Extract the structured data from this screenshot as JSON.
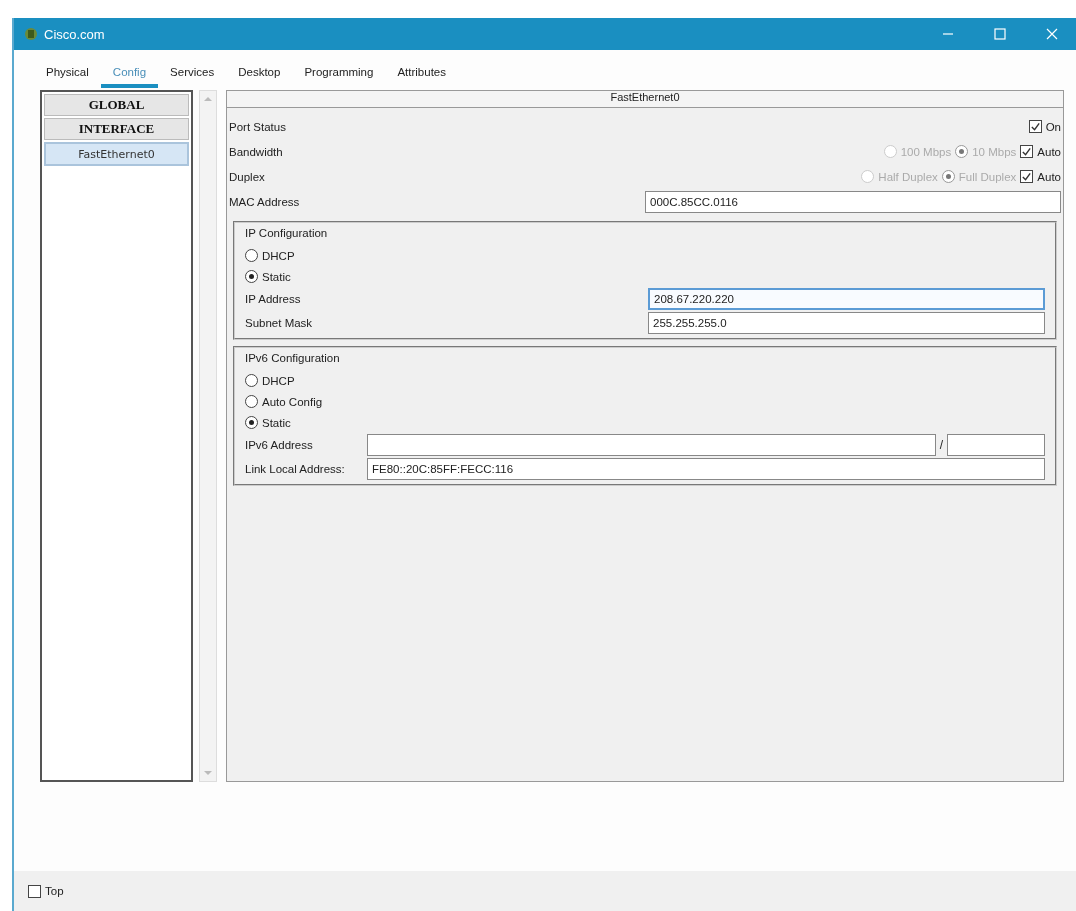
{
  "window": {
    "title": "Cisco.com"
  },
  "tabs": [
    {
      "label": "Physical",
      "selected": false
    },
    {
      "label": "Config",
      "selected": true
    },
    {
      "label": "Services",
      "selected": false
    },
    {
      "label": "Desktop",
      "selected": false
    },
    {
      "label": "Programming",
      "selected": false
    },
    {
      "label": "Attributes",
      "selected": false
    }
  ],
  "sidebar": {
    "items": [
      {
        "label": "GLOBAL",
        "kind": "header",
        "selected": false
      },
      {
        "label": "INTERFACE",
        "kind": "header",
        "selected": false
      },
      {
        "label": "FastEthernet0",
        "kind": "item",
        "selected": true
      }
    ]
  },
  "panel": {
    "title": "FastEthernet0",
    "port_status": {
      "label": "Port Status",
      "on": {
        "label": "On",
        "checked": true
      }
    },
    "bandwidth": {
      "label": "Bandwidth",
      "options": [
        {
          "label": "100 Mbps",
          "selected": false
        },
        {
          "label": "10 Mbps",
          "selected": true
        }
      ],
      "options_disabled": true,
      "auto": {
        "label": "Auto",
        "checked": true
      }
    },
    "duplex": {
      "label": "Duplex",
      "options": [
        {
          "label": "Half Duplex",
          "selected": false
        },
        {
          "label": "Full Duplex",
          "selected": true
        }
      ],
      "options_disabled": true,
      "auto": {
        "label": "Auto",
        "checked": true
      }
    },
    "mac": {
      "label": "MAC Address",
      "value": "000C.85CC.0116"
    },
    "ip_config": {
      "title": "IP Configuration",
      "modes": [
        {
          "label": "DHCP",
          "selected": false
        },
        {
          "label": "Static",
          "selected": true
        }
      ],
      "fields": [
        {
          "label": "IP Address",
          "value": "208.67.220.220",
          "focused": true
        },
        {
          "label": "Subnet Mask",
          "value": "255.255.255.0",
          "focused": false
        }
      ]
    },
    "ipv6_config": {
      "title": "IPv6 Configuration",
      "modes": [
        {
          "label": "DHCP",
          "selected": false
        },
        {
          "label": "Auto Config",
          "selected": false
        },
        {
          "label": "Static",
          "selected": true
        }
      ],
      "address": {
        "label": "IPv6 Address",
        "separator": "/"
      },
      "link_local": {
        "label": "Link Local Address:",
        "value": "FE80::20C:85FF:FECC:116"
      }
    }
  },
  "footer": {
    "top": {
      "label": "Top",
      "checked": false
    }
  }
}
